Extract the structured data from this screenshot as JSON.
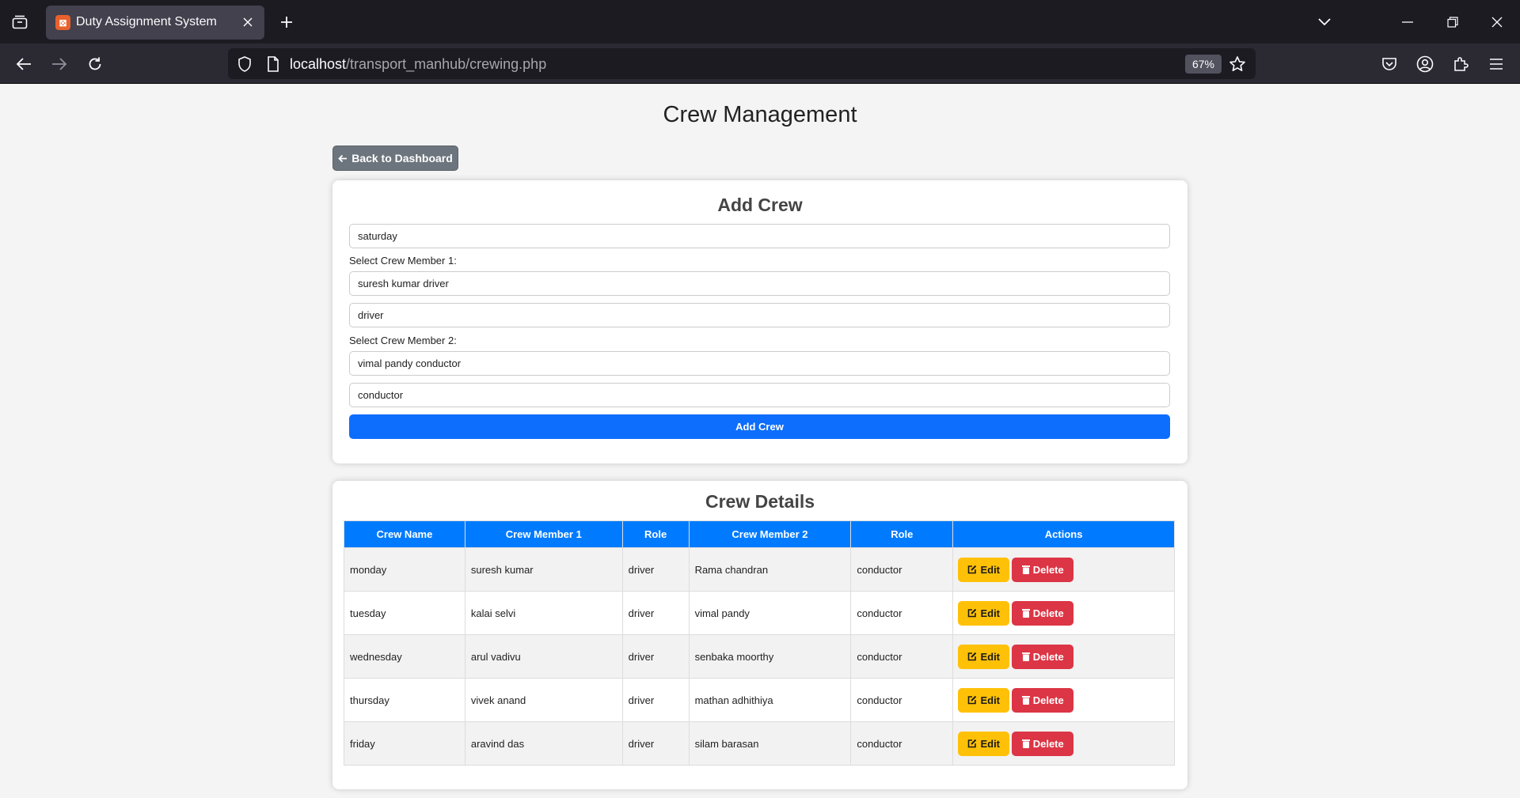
{
  "browser": {
    "tab_title": "Duty Assignment System",
    "tab_favicon": "XAMPP",
    "url_host": "localhost",
    "url_path": "/transport_manhub/crewing.php",
    "zoom": "67%"
  },
  "page": {
    "title": "Crew Management",
    "back_label": "Back to Dashboard"
  },
  "add_form": {
    "heading": "Add Crew",
    "crew_name_value": "saturday",
    "member1_label": "Select Crew Member 1:",
    "member1_value": "suresh kumar driver",
    "member1_role_value": "driver",
    "member2_label": "Select Crew Member 2:",
    "member2_value": "vimal pandy conductor",
    "member2_role_value": "conductor",
    "submit_label": "Add Crew"
  },
  "details": {
    "heading": "Crew Details",
    "columns": [
      "Crew Name",
      "Crew Member 1",
      "Role",
      "Crew Member 2",
      "Role",
      "Actions"
    ],
    "edit_label": "Edit",
    "delete_label": "Delete",
    "rows": [
      {
        "crew_name": "monday",
        "member1": "suresh kumar",
        "role1": "driver",
        "member2": "Rama chandran",
        "role2": "conductor"
      },
      {
        "crew_name": "tuesday",
        "member1": "kalai selvi",
        "role1": "driver",
        "member2": "vimal pandy",
        "role2": "conductor"
      },
      {
        "crew_name": "wednesday",
        "member1": "arul vadivu",
        "role1": "driver",
        "member2": "senbaka moorthy",
        "role2": "conductor"
      },
      {
        "crew_name": "thursday",
        "member1": "vivek anand",
        "role1": "driver",
        "member2": "mathan adhithiya",
        "role2": "conductor"
      },
      {
        "crew_name": "friday",
        "member1": "aravind das",
        "role1": "driver",
        "member2": "silam barasan",
        "role2": "conductor"
      }
    ]
  },
  "colors": {
    "primary": "#0d6efd",
    "table_header": "#007bff",
    "edit": "#ffc107",
    "delete": "#dc3545",
    "secondary": "#6c757d"
  }
}
